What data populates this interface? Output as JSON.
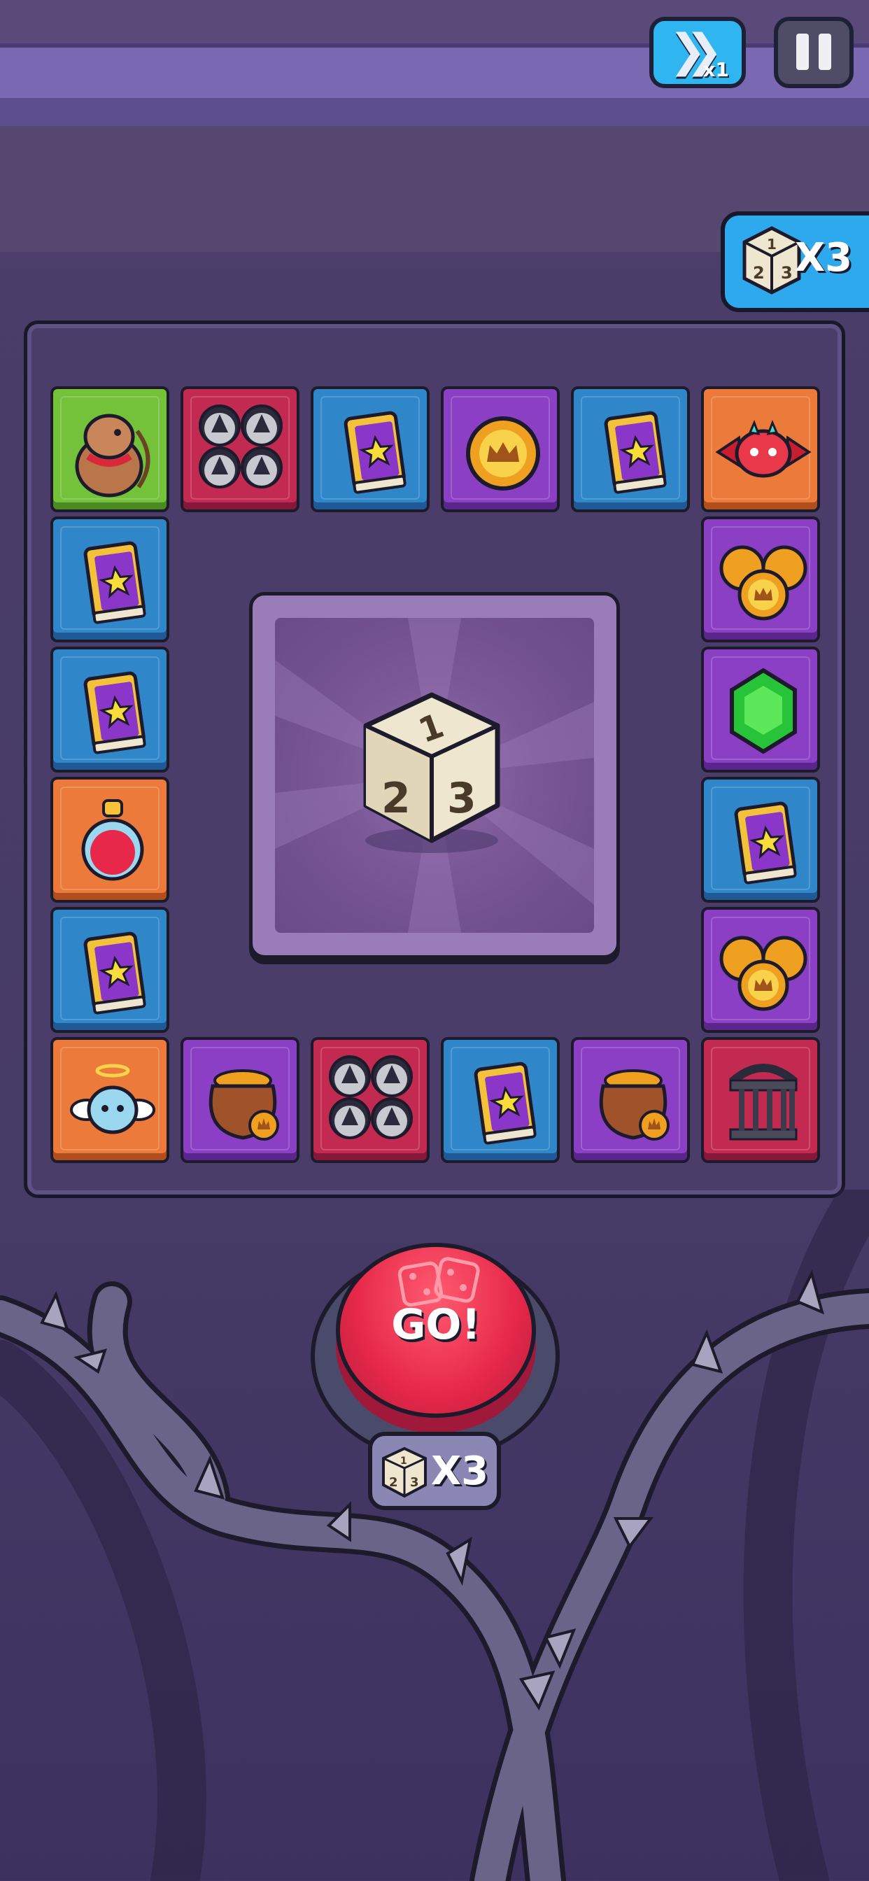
{
  "hud": {
    "speed_label": "x1",
    "dice_count_top": "X3"
  },
  "board": {
    "tiles": [
      {
        "kind": "player-character",
        "color": "green"
      },
      {
        "kind": "spike-trap",
        "color": "red"
      },
      {
        "kind": "skill-book",
        "color": "blue"
      },
      {
        "kind": "crown-coin",
        "color": "purple"
      },
      {
        "kind": "skill-book",
        "color": "blue"
      },
      {
        "kind": "red-bat-enemy",
        "color": "orange"
      },
      {
        "kind": "coin-stack",
        "color": "purple"
      },
      {
        "kind": "green-gem",
        "color": "purple"
      },
      {
        "kind": "skill-book",
        "color": "blue"
      },
      {
        "kind": "coin-stack",
        "color": "purple"
      },
      {
        "kind": "cage",
        "color": "red"
      },
      {
        "kind": "coin-pot",
        "color": "purple"
      },
      {
        "kind": "skill-book",
        "color": "blue"
      },
      {
        "kind": "spike-trap",
        "color": "red"
      },
      {
        "kind": "coin-pot",
        "color": "purple"
      },
      {
        "kind": "angel-ghost",
        "color": "orange"
      },
      {
        "kind": "skill-book",
        "color": "blue"
      },
      {
        "kind": "health-potion",
        "color": "orange"
      },
      {
        "kind": "skill-book",
        "color": "blue"
      },
      {
        "kind": "skill-book",
        "color": "blue"
      }
    ],
    "center_dice_faces": [
      "1",
      "2",
      "3"
    ]
  },
  "roll": {
    "go_label": "GO!",
    "dice_count_bottom": "X3"
  },
  "colors": {
    "blue": "#2f86c8",
    "purple": "#8a3fc4",
    "red": "#c22a52",
    "orange": "#ec7a3a",
    "green": "#74c23a",
    "accent": "#2fa9ee",
    "go": "#e6284a"
  }
}
